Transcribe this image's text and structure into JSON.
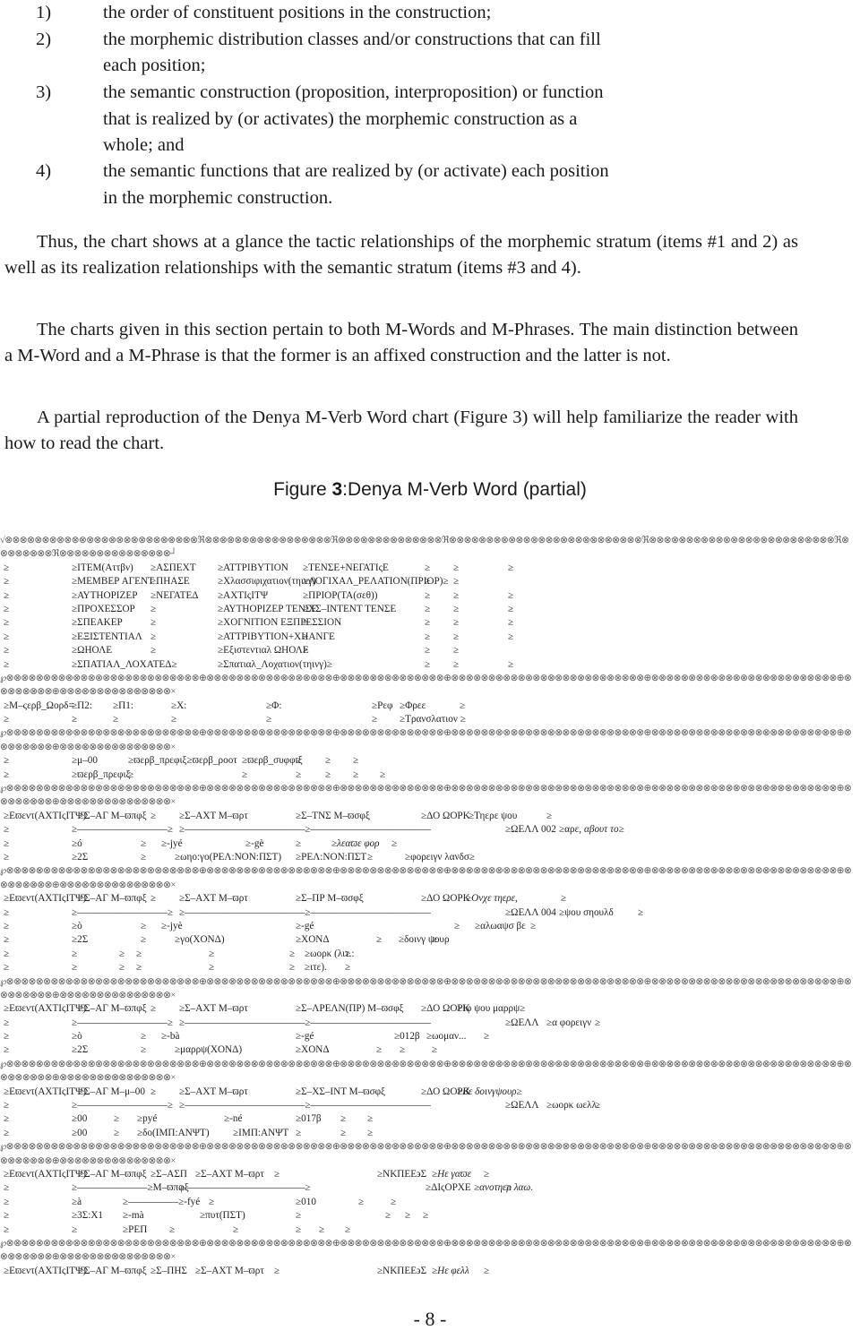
{
  "list_items": [
    {
      "num": "1)",
      "lines": [
        "the order of constituent positions in the construction;"
      ]
    },
    {
      "num": "2)",
      "lines": [
        "the morphemic distribution classes and/or constructions that can fill",
        "each position;"
      ]
    },
    {
      "num": "3)",
      "lines": [
        "the semantic construction (proposition, interproposition) or function",
        "that is realized by (or activates) the morphemic construction as a",
        "whole; and"
      ]
    },
    {
      "num": "4)",
      "lines": [
        "the semantic functions that are realized by (or activate) each position",
        "in the morphemic construction."
      ]
    }
  ],
  "paragraphs": [
    "Thus, the chart shows at a glance the tactic relationships of the morphemic stratum (items #1 and 2) as well as its realization relationships with the semantic stratum (items #3 and 4).",
    "The charts given in this section pertain to both M-Words and M-Phrases. The main distinction between a M-Word and a M-Phrase is that the former is an affixed construction and the latter is not.",
    "A partial reproduction of the Denya M-Verb Word chart (Figure 3) will help familiarize the reader with how to read the chart."
  ],
  "figure": {
    "prefix": "Figure ",
    "number": "3",
    "caption": ":Denya M-Verb Word (partial)"
  },
  "chart": {
    "top_border_1": "√⊗⊗⊗⊗⊗⊗⊗⊗⊗⊗⊗⊗⊗⊗⊗⊗⊗⊗⊗⊗⊗⊗⊗⊗⊗⊗ℜ⊗⊗⊗⊗⊗⊗⊗⊗⊗⊗⊗⊗⊗⊗⊗⊗⊗ℜ⊗⊗⊗⊗⊗⊗⊗⊗⊗⊗⊗⊗⊗⊗ℜ⊗⊗⊗⊗⊗⊗⊗⊗⊗⊗⊗⊗⊗⊗⊗⊗⊗⊗⊗⊗⊗⊗⊗⊗⊗⊗ℜ⊗⊗⊗⊗⊗⊗⊗⊗⊗⊗⊗⊗⊗⊗⊗⊗⊗⊗⊗⊗⊗⊗⊗⊗⊗ℜ⊗",
    "top_border_2": "⊗⊗⊗⊗⊗⊗⊗ℜ⊗⊗⊗⊗⊗⊗⊗⊗⊗⊗⊗⊗⊗⊗⊗┘",
    "sep_1": "℘⊗⊗⊗⊗⊗⊗⊗⊗⊗⊗⊗⊗⊗⊗⊗⊗⊗⊗⊗⊗⊗⊗⊗⊗⊗⊗⊕⊗⊗⊗⊗⊗⊗⊗⊗⊗⊗⊗⊗⊗⊗⊗⊗⊗⊕⊗⊗⊗⊗⊗⊗⊗⊗⊗⊗⊗⊗⊗⊗⊕⊗⊗⊗⊗⊗⊗⊗⊗⊗⊗⊗⊗⊗⊗⊗⊗⊗⊗⊗⊗⊗⊗⊗⊗⊗⊗⊕⊗⊗⊗⊗⊗⊗⊗⊗⊗⊗⊗⊗⊗⊗⊗⊗⊗⊗⊗⊗⊗⊗⊗⊗⊗⊕⊗",
    "sep_2": "⊗⊗⊗⊗⊗⊗⊗⊕⊗⊗⊗⊗⊗⊗⊗⊗⊗⊗⊗⊗⊗⊗⊗×",
    "header_rows": [
      [
        "≥",
        "≥ITEM(Aττβν)",
        "≥ΑΣΠΕΧΤ",
        "≥ΑΤΤΡΙΒΥΤΙΟΝ",
        "≥ΤΕΝΣΕ+ΝΕΓΑΤΙςΕ",
        "≥",
        "≥",
        "≥"
      ],
      [
        "≥",
        "≥ΜΕΜΒΕΡ ΑΓΕΝΤ",
        "≥ΠΗΑΣΕ",
        "≥Χλασσιφιχατιον(τηινγ)",
        "≥ΛΟΓΙΧΑΛ_ΡΕΛΑΤΙΟΝ(ΠΡΙΟΡ)≥",
        "≥",
        "≥",
        ""
      ],
      [
        "≥",
        "≥ΑΥΤΗΟΡΙΖΕΡ",
        "≥ΝΕΓΑΤΕΔ",
        "≥ΑΧΤΙςΙΤΨ",
        "≥ΠΡΙΟΡ(ΤΑ(σεθ))",
        "≥",
        "≥",
        "≥"
      ],
      [
        "≥",
        "≥ΠΡΟΧΕΣΣΟΡ",
        "≥",
        "≥ΑΥΤΗΟΡΙΖΕΡ ΤΕΝΣΕ",
        "≥ΧΣ–ΙΝΤΕΝΤ ΤΕΝΣΕ",
        "≥",
        "≥",
        "≥"
      ],
      [
        "≥",
        "≥ΣΠΕΑΚΕΡ",
        "≥",
        "≥ΧΟΓΝΙΤΙΟΝ ΕΞΠΡΕΣΣΙΟΝ",
        "≥",
        "≥",
        "≥",
        "≥"
      ],
      [
        "≥",
        "≥ΕΞΙΣΤΕΝΤΙΑΛ",
        "≥",
        "≥ΑΤΤΡΙΒΥΤΙΟΝ+ΧΗΑΝΓΕ",
        "≥",
        "≥",
        "≥",
        "≥"
      ],
      [
        "≥",
        "≥ΩΗΟΛΕ",
        "≥",
        "≥Εξιστεντιαλ ΩΗΟΛΕ",
        "≥",
        "≥",
        "≥",
        ""
      ],
      [
        "≥",
        "≥ΣΠΑΤΙΑΛ_ΛΟΧΑΤΕΔ≥",
        "",
        "≥Σπατιαλ_Λοχατιον(τηινγ)≥",
        "",
        "≥",
        "≥",
        "≥"
      ]
    ],
    "sections": [
      {
        "rows": [
          [
            "≥Μ–ςερβ_Ωορδ=",
            "≥Π2:",
            "≥Π1:",
            "≥Χ:",
            "≥Φ:",
            "≥Ρεφ",
            "≥Φρεε",
            "≥"
          ],
          [
            "≥",
            "≥",
            "≥",
            "≥",
            "≥",
            "≥",
            "≥Τρανσλατιον ≥",
            ""
          ]
        ]
      },
      {
        "rows": [
          [
            "≥",
            "≥μ–00",
            "≥ϖερβ_πρεφιξ≥ϖερβ_ροοτ",
            "≥ϖερβ_συφφιξ",
            "≥",
            "≥",
            "≥",
            ""
          ],
          [
            "≥",
            "≥ϖερβ_πρεφιξ",
            "≥",
            "≥",
            "≥",
            "≥",
            "≥",
            "≥"
          ]
        ]
      },
      {
        "rows": [
          [
            "≥Εϖεντ(ΑΧΤΙςΙΤΨ)",
            "≥Σ–ΑΓ Μ–ϖπφξ",
            "≥",
            "≥Σ–ΑΧΤ Μ–ϖρτ",
            "≥Σ–ΤΝΣ Μ–ϖσφξ",
            "≥ΔΟ ΩΟΡΚ",
            "≥Τηερε ψου",
            "≥"
          ],
          [
            "≥",
            "≥—————————≥",
            "",
            "≥————————————≥————————————",
            "",
            "≥ΩΕΛΛ 002",
            "≥αρε, ",
            "αβουτ το≥"
          ],
          [
            "≥",
            "≥ó",
            "≥",
            "≥-jyé",
            "≥-gè",
            "≥",
            "≥λεαϖε φορ",
            "≥"
          ],
          [
            "≥",
            "≥2Σ",
            "≥",
            "≥ωηο:γο(ΡΕΛ:ΝΟΝ:ΠΣΤ)",
            "≥ΡΕΛ:ΝΟΝ:ΠΣΤ",
            "≥",
            "≥φορειγν λανδσ≥",
            ""
          ]
        ]
      },
      {
        "rows": [
          [
            "≥Εϖεντ(ΑΧΤΙςΙΤΨ)",
            "≥Σ–ΑΓ Μ–ϖπφξ",
            "≥",
            "≥Σ–ΑΧΤ Μ–ϖρτ",
            "≥Σ–ΠΡ Μ–ϖσφξ",
            "≥ΔΟ ΩΟΡΚ",
            "≥Ονχε τηερε,",
            "≥"
          ],
          [
            "≥",
            "≥—————————≥",
            "",
            "≥————————————≥————————————",
            "",
            "≥ΩΕΛΛ 004",
            "≥ψου σηουλδ",
            "≥"
          ],
          [
            "≥",
            "≥ò",
            "≥",
            "≥-jyè",
            "≥-gé",
            "≥",
            "≥αλωαψσ βε",
            "≥"
          ],
          [
            "≥",
            "≥2Σ",
            "≥",
            "≥γο(ΧΟΝΔ)",
            "≥ΧΟΝΔ",
            "≥",
            "≥δοινγ ψουρ",
            "≥"
          ],
          [
            "≥",
            "≥",
            "≥",
            "≥",
            "≥",
            "≥",
            "≥ωορκ (λιτ.:",
            "≥"
          ],
          [
            "≥",
            "≥",
            "≥",
            "≥",
            "≥",
            "≥",
            "≥ιτε).",
            "≥"
          ]
        ]
      },
      {
        "rows": [
          [
            "≥Εϖεντ(ΑΧΤΙςΙΤΨ)",
            "≥Σ–ΑΓ Μ–ϖπφξ",
            "≥",
            "≥Σ–ΑΧΤ Μ–ϖρτ",
            "≥Σ–ΛΡΕΛΝ(ΠΡ) Μ–ϖσφξ",
            "≥ΔΟ ΩΟΡΚ",
            "≥Ιφ ψου μαρρψ≥",
            ""
          ],
          [
            "≥",
            "≥—————————≥",
            "",
            "≥————————————≥————————————",
            "",
            "≥ΩΕΛΛ",
            "≥α φορειγν",
            "≥"
          ],
          [
            "≥",
            "≥ò",
            "≥",
            "≥-bà",
            "≥-gé",
            "≥012β",
            "≥ωομαν...",
            "≥"
          ],
          [
            "≥",
            "≥2Σ",
            "≥",
            "≥μαρρψ(ΧΟΝΔ)",
            "≥ΧΟΝΔ",
            "≥",
            "≥",
            "≥"
          ]
        ]
      },
      {
        "rows": [
          [
            "≥Εϖεντ(ΑΧΤΙςΙΤΨ)",
            "≥Σ–ΑΓ Μ–μ–00",
            "≥",
            "≥Σ–ΑΧΤ Μ–ϖρτ",
            "≥Σ–ΧΣ–ΙΝΤ Μ–ϖσφξ",
            "≥ΔΟ ΩΟΡΚ",
            "≥Βε δοινγψουρ≥",
            ""
          ],
          [
            "≥",
            "≥—————————≥",
            "",
            "≥————————————≥————————————",
            "",
            "≥ΩΕΛΛ",
            "≥ωορκ ωελλ.",
            "≥"
          ],
          [
            "≥",
            "≥00",
            "≥",
            "≥pyé",
            "≥-né",
            "≥017β",
            "≥",
            "≥"
          ],
          [
            "≥",
            "≥00",
            "≥",
            "≥δο(ΙΜΠ:ΑΝΨΤ)",
            "≥ΙΜΠ:ΑΝΨΤ",
            "≥",
            "≥",
            "≥"
          ]
        ]
      },
      {
        "rows": [
          [
            "≥Εϖεντ(ΑΧΤΙςΙΤΨ)",
            "≥Σ–ΑΓ Μ–ϖπφξ",
            "≥Σ–ΑΣΠ",
            "≥Σ–ΑΧΤ Μ–ϖρτ",
            "≥",
            "≥ΝΚΠΕΕ϶Σ",
            "≥Ηε γαϖε",
            "≥"
          ],
          [
            "≥",
            "≥———————≥Μ–ϖπφξ",
            "",
            "≥————————————≥",
            "",
            "≥ΔΙςΟΡΧΕ",
            "≥ανοτηερ λαω.",
            "≥"
          ],
          [
            "≥",
            "≥à",
            "≥—————≥-fyé",
            "≥",
            "≥010",
            "≥",
            "≥",
            ""
          ],
          [
            "≥",
            "≥3Σ:Χ1",
            "≥-mà",
            "≥πυτ(ΠΣΤ)",
            "≥",
            "≥",
            "≥",
            "≥"
          ],
          [
            "≥",
            "≥",
            "≥ΡΕΠ",
            "≥",
            "≥",
            "≥",
            "≥",
            "≥"
          ]
        ]
      },
      {
        "rows": [
          [
            "≥Εϖεντ(ΑΧΤΙςΙΤΨ)",
            "≥Σ–ΑΓ Μ–ϖπφξ",
            "≥Σ–ΠΗΣ",
            "≥Σ–ΑΧΤ Μ–ϖρτ",
            "≥",
            "≥ΝΚΠΕΕ϶Σ",
            "≥Ηε φελλ",
            "≥"
          ]
        ]
      }
    ]
  },
  "page_number": "- 8 -"
}
